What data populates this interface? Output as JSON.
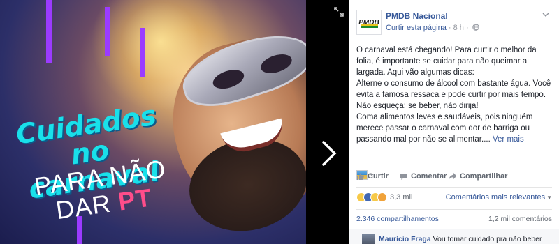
{
  "photo": {
    "headline_line1": "Cuidados",
    "headline_line2": "no carnaval",
    "sub_line1": "PARA NÃO",
    "sub_line2": "DAR",
    "sub_highlight": "PT"
  },
  "post": {
    "page_name": "PMDB Nacional",
    "avatar_text": "PMDB",
    "like_page_link": "Curtir esta página",
    "separator": "·",
    "time": "8 h",
    "paragraphs": [
      "O carnaval está chegando! Para curtir o melhor da folia, é importante se cuidar para não queimar a largada. Aqui vão algumas dicas:",
      "Alterne o consumo de álcool com bastante água. Você evita a famosa ressaca e pode curtir por mais tempo. Não esqueça: se beber, não dirija!",
      "Coma alimentos leves e saudáveis, pois ninguém merece passar o carnaval com dor de barriga ou passando mal por não se alimentar...."
    ],
    "see_more": "Ver mais"
  },
  "actions": {
    "like": "Curtir",
    "comment": "Comentar",
    "share": "Compartilhar"
  },
  "reactions": {
    "count": "3,3 mil",
    "sort_label": "Comentários mais relevantes"
  },
  "stats": {
    "shares": "2.346 compartilhamentos",
    "comments": "1,2 mil comentários"
  },
  "first_comment": {
    "author": "Maurício Fraga",
    "text": "Vou tomar cuidado pra não beber"
  },
  "colors": {
    "link": "#365899",
    "headline_cyan": "#19e0ea",
    "pt_pink": "#ff4d8a",
    "stripe_purple": "#9b3bff"
  }
}
